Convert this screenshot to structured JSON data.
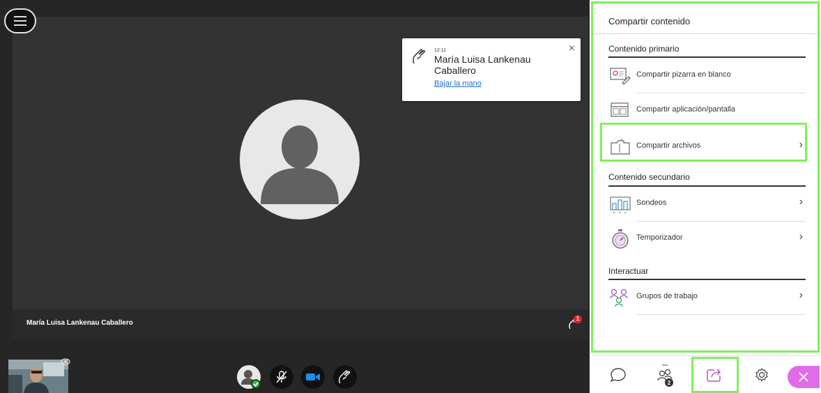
{
  "notification": {
    "time": "12:11",
    "name": "María Luisa Lankenau Caballero",
    "action": "Bajar la mano",
    "close": "×"
  },
  "video": {
    "participant_name": "María Luisa Lankenau Caballero",
    "raised_hands_count": "1"
  },
  "panel": {
    "title": "Compartir contenido",
    "sections": {
      "primary": "Contenido primario",
      "secondary": "Contenido secundario",
      "interact": "Interactuar"
    },
    "items": {
      "whiteboard": "Compartir pizarra en blanco",
      "app_screen": "Compartir aplicación/pantalla",
      "files": "Compartir archivos",
      "polls": "Sondeos",
      "timer": "Temporizador",
      "groups": "Grupos de trabajo"
    },
    "chevron": "›"
  },
  "tabbar": {
    "attendees_count": "2"
  },
  "colors": {
    "highlight": "#7ff05a",
    "accent_purple": "#e16ce6",
    "camera_blue": "#1e8fe6",
    "link_blue": "#1f6fd1"
  }
}
